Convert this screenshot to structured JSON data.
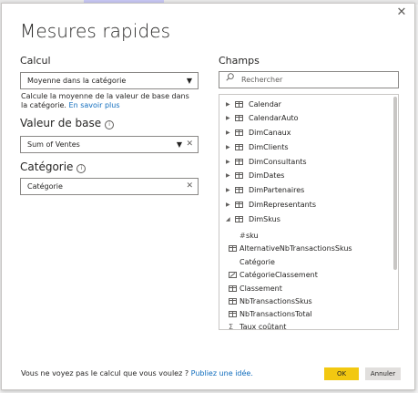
{
  "dialog": {
    "title": "Mesures rapides",
    "close_glyph": "✕"
  },
  "calcul": {
    "label": "Calcul",
    "selected": "Moyenne dans la catégorie",
    "description": "Calcule la moyenne de la valeur de base dans la catégorie.",
    "learn_more": "En savoir plus"
  },
  "base_value": {
    "label": "Valeur de base",
    "value": "Sum of Ventes"
  },
  "category": {
    "label": "Catégorie",
    "value": "Catégorie"
  },
  "fields": {
    "label": "Champs",
    "search_placeholder": "Rechercher",
    "tables": [
      "Calendar",
      "CalendarAuto",
      "DimCanaux",
      "DimClients",
      "DimConsultants",
      "DimDates",
      "DimPartenaires",
      "DimRepresentants",
      "DimSkus"
    ],
    "expanded_table": "DimSkus",
    "dimskus_fields": [
      {
        "name": "sku",
        "icon": "hash-icon"
      },
      {
        "name": "AlternativeNbTransactionsSkus",
        "icon": "measure-table-icon"
      },
      {
        "name": "Catégorie",
        "icon": "none"
      },
      {
        "name": "CatégorieClassement",
        "icon": "calculated-icon"
      },
      {
        "name": "Classement",
        "icon": "measure-table-icon"
      },
      {
        "name": "NbTransactionsSkus",
        "icon": "measure-table-icon"
      },
      {
        "name": "NbTransactionsTotal",
        "icon": "measure-table-icon"
      },
      {
        "name": "Taux coûtant",
        "icon": "sigma-icon"
      }
    ]
  },
  "footer": {
    "question": "Vous ne voyez pas le calcul que vous voulez ?",
    "link": "Publiez une idée."
  },
  "buttons": {
    "ok": "OK",
    "cancel": "Annuler"
  },
  "colors": {
    "accent_ok": "#f2c811",
    "link": "#0f6cbd",
    "cancel_bg": "#e1dfdd"
  }
}
